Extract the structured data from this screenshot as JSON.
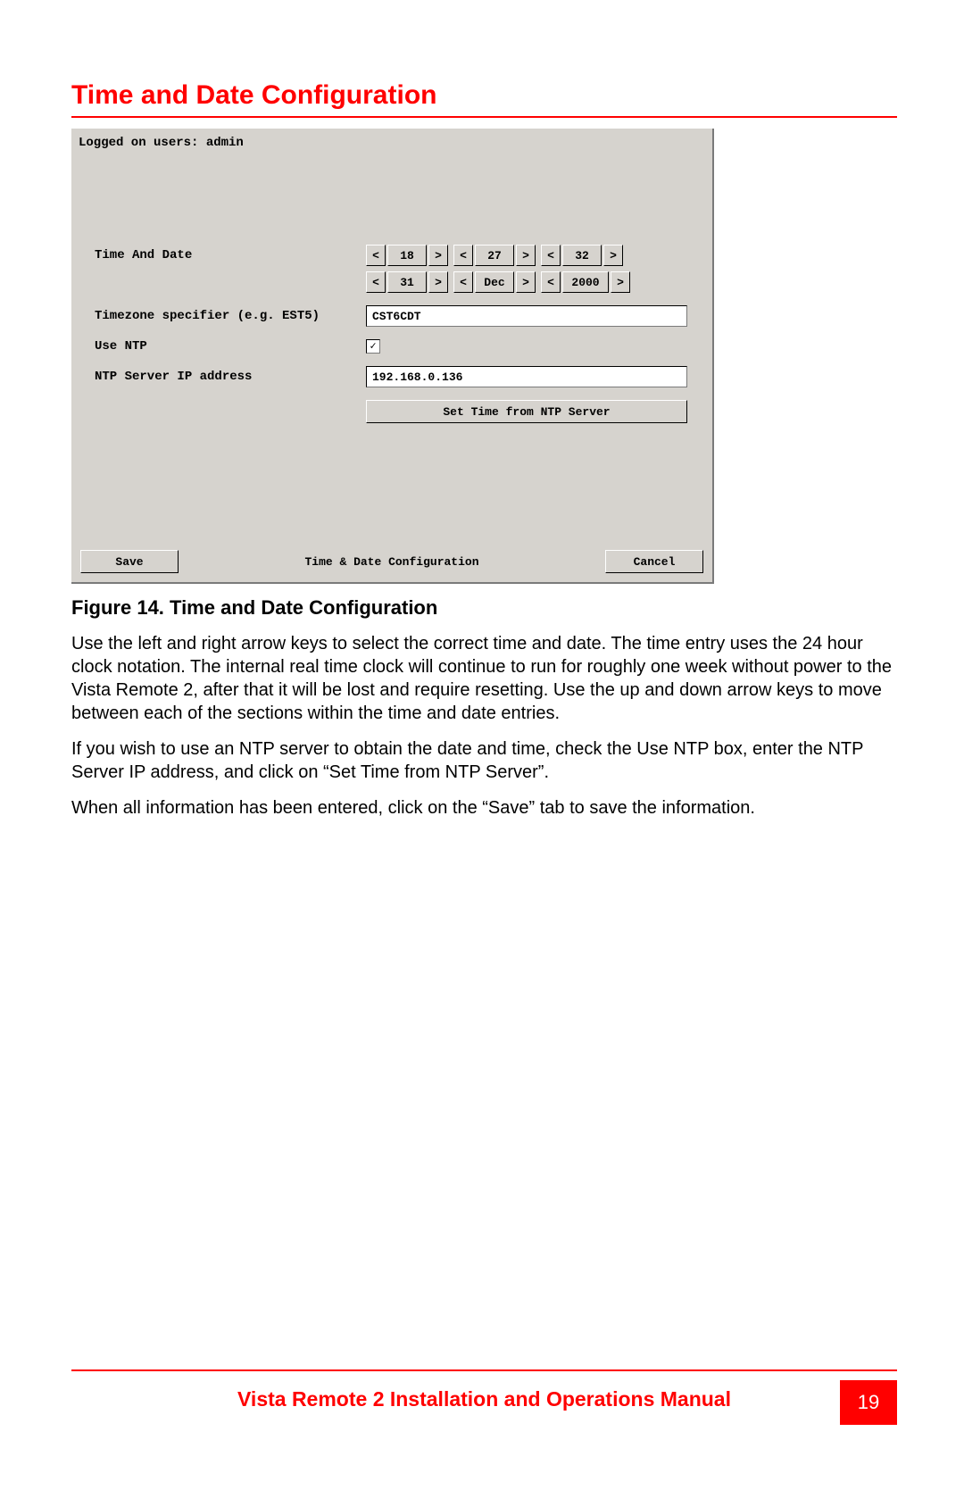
{
  "title": "Time and Date Configuration",
  "dialog": {
    "logged_on": "Logged on users: admin",
    "labels": {
      "time_and_date": "Time And Date",
      "timezone": "Timezone specifier (e.g. EST5)",
      "use_ntp": "Use NTP",
      "ntp_ip": "NTP Server IP address"
    },
    "time_row1": {
      "hour": "18",
      "min": "27",
      "sec": "32"
    },
    "time_row2": {
      "day": "31",
      "month": "Dec",
      "year": "2000"
    },
    "arrows": {
      "left": "<",
      "right": ">"
    },
    "timezone_value": "CST6CDT",
    "use_ntp_checked": "✓",
    "ntp_ip_value": "192.168.0.136",
    "set_time_btn": "Set Time from NTP Server",
    "save_btn": "Save",
    "bottom_title": "Time & Date Configuration",
    "cancel_btn": "Cancel"
  },
  "figure_caption": "Figure 14. Time and Date Configuration",
  "para1": "Use the left and right arrow keys to select the correct time and date. The time entry uses the 24 hour clock notation. The internal real time clock will continue to run for roughly one week without power to the Vista Remote 2, after that it will be lost and require resetting. Use the up and down arrow keys to move between each of the sections within the time and date entries.",
  "para2": "If you wish to use an NTP server to obtain the date and time, check the Use NTP box, enter the NTP Server IP address, and click on “Set Time from NTP Server”.",
  "para3": "When all information has been entered, click on the “Save” tab to save the information.",
  "footer_title": "Vista Remote 2 Installation and Operations Manual",
  "page_number": "19"
}
